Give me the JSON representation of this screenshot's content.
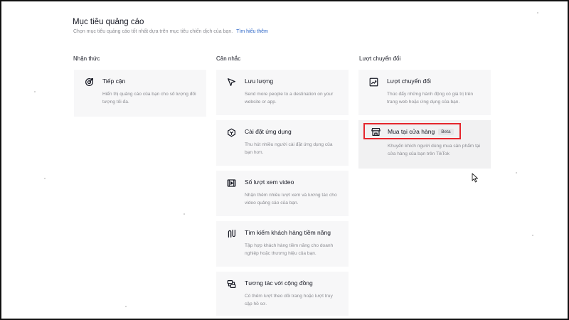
{
  "header": {
    "title": "Mục tiêu quảng cáo",
    "subtitle": "Chọn mục tiêu quảng cáo tốt nhất dựa trên mục tiêu chiến dịch của bạn.",
    "link": "Tìm hiểu thêm"
  },
  "columns": [
    {
      "heading": "Nhận thức",
      "cards": [
        {
          "icon": "target-icon",
          "title": "Tiếp cận",
          "desc": "Hiển thị quảng cáo của bạn cho số lượng đối tượng tối đa."
        }
      ]
    },
    {
      "heading": "Cân nhắc",
      "cards": [
        {
          "icon": "cursor-arrow-icon",
          "title": "Lưu lượng",
          "desc": "Send more people to a destination on your website or app."
        },
        {
          "icon": "app-cube-icon",
          "title": "Cài đặt ứng dụng",
          "desc": "Thu hút nhiều người cài đặt ứng dụng của bạn hơn."
        },
        {
          "icon": "video-icon",
          "title": "Số lượt xem video",
          "desc": "Nhận thêm nhiều lượt xem và lương tác cho video quảng cáo của bạn."
        },
        {
          "icon": "funnel-icon",
          "title": "Tìm kiếm khách hàng tiềm năng",
          "desc": "Tập hợp khách hàng tiềm năng cho doanh nghiệp hoặc thương hiệu của bạn."
        },
        {
          "icon": "community-icon",
          "title": "Tương tác với cộng đồng",
          "desc": "Có thêm lượt theo dõi trang hoặc lượt truy cập hồ sơ."
        }
      ]
    },
    {
      "heading": "Lượt chuyển đổi",
      "cards": [
        {
          "icon": "chart-up-icon",
          "title": "Lượt chuyển đổi",
          "desc": "Thúc đẩy những hành động có giá trị trên trang web hoặc ứng dụng của bạn."
        },
        {
          "icon": "store-icon",
          "title": "Mua tại cửa hàng",
          "badge": "Beta",
          "desc": "Khuyến khích người dùng mua sản phẩm tại cửa hàng của bạn trên TikTok"
        }
      ]
    }
  ],
  "colors": {
    "highlight": "#e5262d",
    "link": "#2a64c6",
    "card_bg": "#f7f7f8"
  }
}
